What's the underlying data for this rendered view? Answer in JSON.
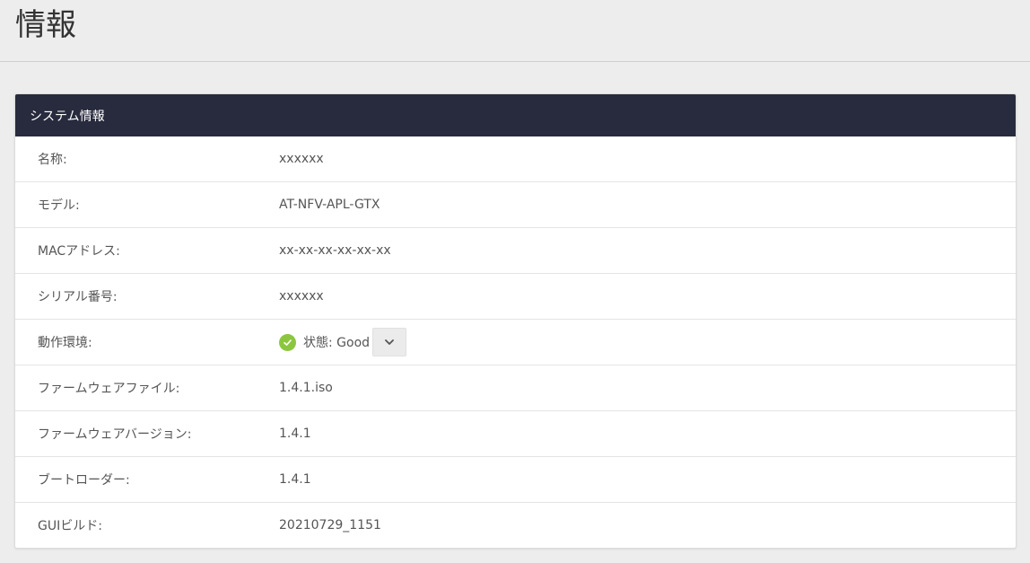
{
  "page": {
    "title": "情報"
  },
  "system_info": {
    "panel_title": "システム情報",
    "rows": [
      {
        "label": "名称:",
        "value": "xxxxxx"
      },
      {
        "label": "モデル:",
        "value": "AT-NFV-APL-GTX"
      },
      {
        "label": "MACアドレス:",
        "value": "xx-xx-xx-xx-xx-xx"
      },
      {
        "label": "シリアル番号:",
        "value": "xxxxxx"
      },
      {
        "label": "動作環境:",
        "value": "状態: Good"
      },
      {
        "label": "ファームウェアファイル:",
        "value": "1.4.1.iso"
      },
      {
        "label": "ファームウェアバージョン:",
        "value": "1.4.1"
      },
      {
        "label": "ブートローダー:",
        "value": "1.4.1"
      },
      {
        "label": "GUIビルド:",
        "value": "20210729_1151"
      }
    ]
  },
  "colors": {
    "panel_header": "#282b3d",
    "status_ok": "#8cc63f",
    "background": "#ededed"
  },
  "icons": {
    "status": "check-circle-icon",
    "expand": "chevron-down-icon"
  }
}
